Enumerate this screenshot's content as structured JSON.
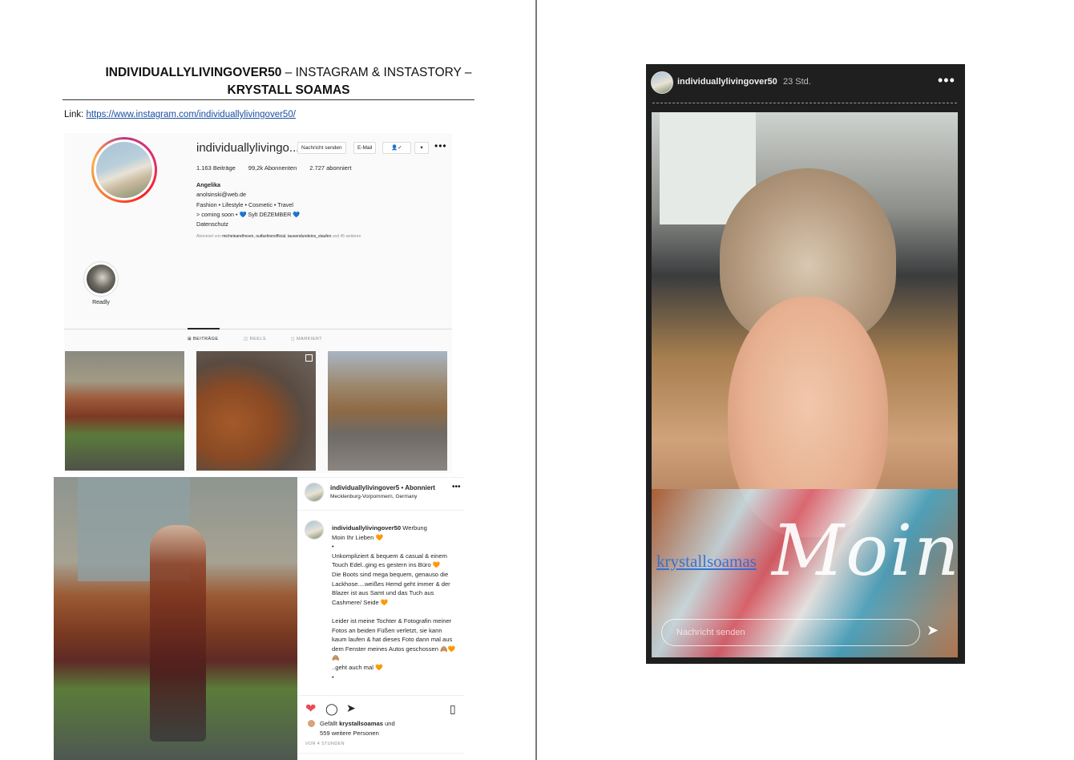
{
  "header": {
    "title_bold": "INDIVIDUALLYLIVINGOVER50",
    "title_rest": " – INSTAGRAM & INSTASTORY –",
    "title_line2": "KRYSTALL SOAMAS",
    "link_label": "Link: ",
    "link_url": "https://www.instagram.com/individuallylivingover50/"
  },
  "profile": {
    "username": "individuallylivingo...",
    "buttons": [
      "Nachricht senden",
      "E-Mail",
      "👤✓",
      "▾"
    ],
    "more": "•••",
    "posts": "1.163 Beiträge",
    "followers": "99,2k Abonnenten",
    "following": "2.727 abonniert",
    "bio": {
      "name": "Angelika",
      "email": "anolsinski@web.de",
      "line1": "Fashion • Lifestyle • Cosmetic • Travel",
      "line2": "> coming soon • 💙 Sylt DEZEMBER 💙",
      "line3": "Datenschutz"
    },
    "followed_prefix": "Abonniert von ",
    "followed_names": "micheleandhoven, ouifashionofficial, tausendundeins_staufen",
    "followed_suffix": " und 45 weiteren",
    "highlight_label": "Readly",
    "tabs": [
      "⊞ BEITRÄGE",
      "◫ REELS",
      "◻ MARKIERT"
    ]
  },
  "post": {
    "header_user": "individuallylivingover5 • Abonniert",
    "header_location": "Mecklenburg-Vorpommern, Germany",
    "more": "•••",
    "caption_user": "individuallylivingover50",
    "caption_tag": " Werbung",
    "caption_lines": [
      "Moin Ihr Lieben 🧡",
      "•",
      "Unkompliziert & bequem & casual & einem Touch Edel..ging es gestern ins Büro 🧡",
      "Die Boots sind mega bequem, genauso die Lackhose....weißes Hemd geht immer & der Blazer ist aus Samt und das Tuch aus Cashmere/ Seide 🧡",
      "",
      "Leider ist meine Tochter & Fotografin meiner Fotos an beiden Füßen verletzt, sie kann kaum laufen & hat dieses Foto dann mal aus dem Fenster meines Autos geschossen 🙈🧡🙈",
      "..geht auch mal 🧡",
      "•"
    ],
    "likes_prefix": "Gefällt ",
    "likes_user": "krystallsoamas",
    "likes_suffix": " und",
    "likes_line2": "559 weitere Personen",
    "time_ago": "VOR 4 STUNDEN"
  },
  "story": {
    "username": "individuallylivingover50",
    "time": "23 Std.",
    "more": "•••",
    "mention": "krystallsoamas",
    "handwriting": "Moin",
    "reply_placeholder": "Nachricht senden"
  },
  "icons": {
    "heart": "heart-icon",
    "comment": "comment-icon",
    "share": "share-icon",
    "bookmark": "bookmark-icon",
    "send": "send-icon"
  },
  "colors": {
    "link": "#1a4fa0",
    "like_red": "#ed4956",
    "story_bg": "#1f1f1f",
    "mention_blue": "#2b6bd6"
  }
}
